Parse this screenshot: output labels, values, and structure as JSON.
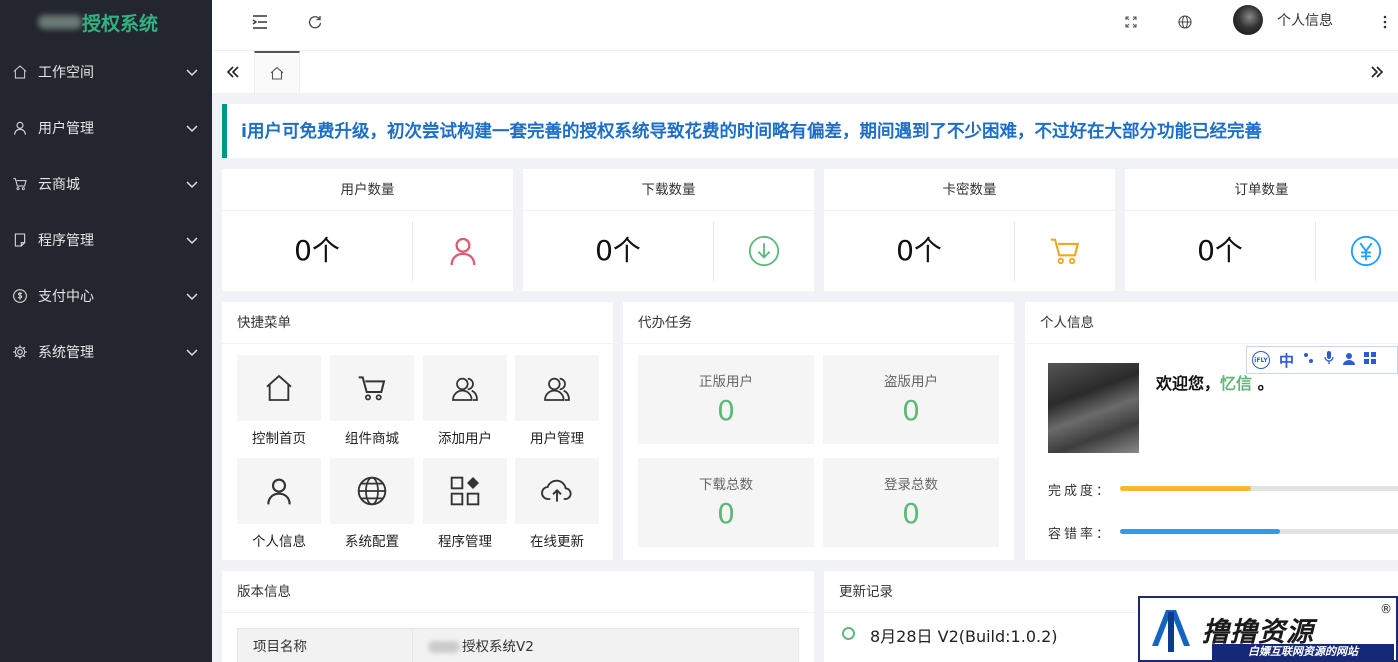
{
  "app": {
    "title": "授权系统",
    "accent": "#009688",
    "sidebar_bg": "#23262e"
  },
  "sidebar": {
    "items": [
      {
        "label": "工作空间",
        "icon": "home-icon"
      },
      {
        "label": "用户管理",
        "icon": "user-icon"
      },
      {
        "label": "云商城",
        "icon": "cart-icon"
      },
      {
        "label": "程序管理",
        "icon": "document-icon"
      },
      {
        "label": "支付中心",
        "icon": "dollar-icon"
      },
      {
        "label": "系统管理",
        "icon": "gear-icon"
      }
    ]
  },
  "header": {
    "user_label": "个人信息"
  },
  "notice": {
    "text": "i用户可免费升级，初次尝试构建一套完善的授权系统导致花费的时间略有偏差，期间遇到了不少困难，不过好在大部分功能已经完善"
  },
  "stats": [
    {
      "title": "用户数量",
      "value": "0个",
      "icon": "user-icon",
      "color": "#e05b6f"
    },
    {
      "title": "下载数量",
      "value": "0个",
      "icon": "download-icon",
      "color": "#5fb878"
    },
    {
      "title": "卡密数量",
      "value": "0个",
      "icon": "cart-icon",
      "color": "#f0a823"
    },
    {
      "title": "订单数量",
      "value": "0个",
      "icon": "yen-icon",
      "color": "#1e9fff"
    }
  ],
  "quick_menu": {
    "title": "快捷菜单",
    "items": [
      {
        "label": "控制首页",
        "icon": "home-icon"
      },
      {
        "label": "组件商城",
        "icon": "cart-icon"
      },
      {
        "label": "添加用户",
        "icon": "users-icon"
      },
      {
        "label": "用户管理",
        "icon": "users-icon"
      },
      {
        "label": "个人信息",
        "icon": "user-icon"
      },
      {
        "label": "系统配置",
        "icon": "globe-icon"
      },
      {
        "label": "程序管理",
        "icon": "apps-icon"
      },
      {
        "label": "在线更新",
        "icon": "cloud-upload-icon"
      }
    ]
  },
  "todo": {
    "title": "代办任务",
    "items": [
      {
        "label": "正版用户",
        "value": "0"
      },
      {
        "label": "盗版用户",
        "value": "0"
      },
      {
        "label": "下载总数",
        "value": "0"
      },
      {
        "label": "登录总数",
        "value": "0"
      }
    ]
  },
  "profile": {
    "title": "个人信息",
    "welcome": "欢迎您，",
    "name": "忆信",
    "suffix": " 。",
    "progress": [
      {
        "label": "完成度：",
        "value": 0.45,
        "color": "#f7b62e"
      },
      {
        "label": "容错率：",
        "value": 0.55,
        "color": "#2d9bf0"
      }
    ]
  },
  "version": {
    "title": "版本信息",
    "rows": [
      {
        "key": "项目名称",
        "value": "授权系统V2"
      }
    ]
  },
  "changelog": {
    "title": "更新记录",
    "entries": [
      {
        "title": "8月28日 V2(Build:1.0.2)"
      }
    ]
  },
  "ime": {
    "label_ifly": "iFLY",
    "label_zh": "中"
  },
  "watermark": {
    "title": "撸撸资源",
    "subtitle": "白嫖互联网资源的网站",
    "reg": "®"
  }
}
